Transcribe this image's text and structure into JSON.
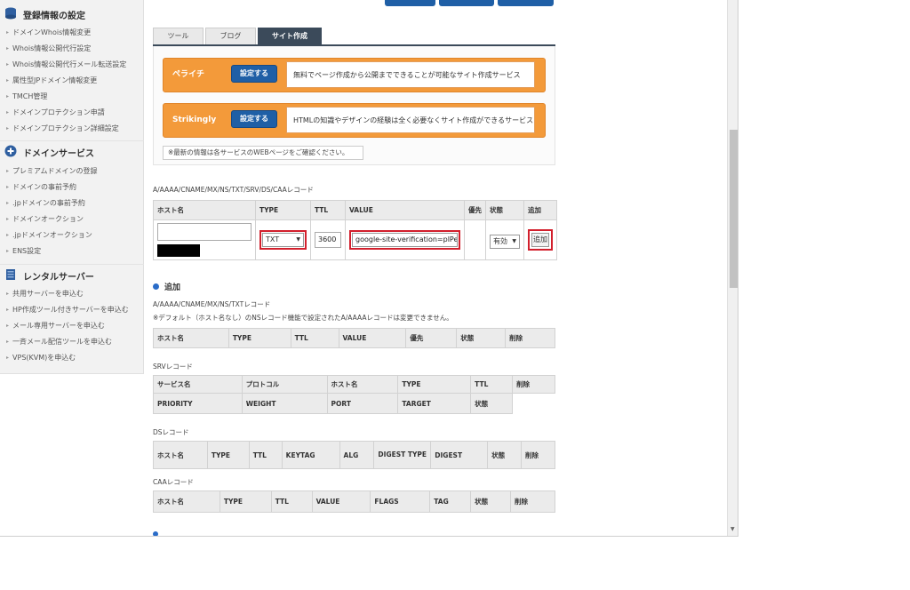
{
  "sidebar": {
    "sections": [
      {
        "title": "登録情報の設定",
        "items": [
          "ドメインWhois情報変更",
          "Whois情報公開代行設定",
          "Whois情報公開代行メール転送設定",
          "属性型JPドメイン情報変更",
          "TMCH管理",
          "ドメインプロテクション申請",
          "ドメインプロテクション詳細設定"
        ]
      },
      {
        "title": "ドメインサービス",
        "items": [
          "プレミアムドメインの登録",
          "ドメインの事前予約",
          ".jpドメインの事前予約",
          "ドメインオークション",
          ".jpドメインオークション",
          "ENS設定"
        ]
      },
      {
        "title": "レンタルサーバー",
        "items": [
          "共用サーバーを申込む",
          "HP作成ツール付きサーバーを申込む",
          "メール専用サーバーを申込む",
          "一斉メール配信ツールを申込む",
          "VPS(KVM)を申込む"
        ]
      }
    ]
  },
  "tabs": [
    "ツール",
    "ブログ",
    "サイト作成"
  ],
  "promos": [
    {
      "name": "ペライチ",
      "button": "設定する",
      "desc": "無料でページ作成から公開までできることが可能なサイト作成サービス"
    },
    {
      "name": "Strikingly",
      "button": "設定する",
      "desc": "HTMLの知識やデザインの経験は全く必要なくサイト作成ができるサービス"
    }
  ],
  "notice": "※最新の情報は各サービスのWEBページをご確認ください。",
  "add_form": {
    "label": "A/AAAA/CNAME/MX/NS/TXT/SRV/DS/CAAレコード",
    "headers": [
      "ホスト名",
      "TYPE",
      "TTL",
      "VALUE",
      "優先",
      "状態",
      "追加"
    ],
    "host_value": "",
    "type_value": "TXT",
    "ttl_value": "3600",
    "value_value": "google-site-verification=plPe",
    "status_value": "有効",
    "add_button": "追加"
  },
  "add_heading": "追加",
  "records": {
    "label": "A/AAAA/CNAME/MX/NS/TXTレコード",
    "note": "※デフォルト（ホスト名なし）のNSレコード機能で設定されたA/AAAAレコードは変更できません。",
    "headers": [
      "ホスト名",
      "TYPE",
      "TTL",
      "VALUE",
      "優先",
      "状態",
      "削除"
    ]
  },
  "srv": {
    "label": "SRVレコード",
    "row1": [
      "サービス名",
      "プロトコル",
      "ホスト名",
      "TYPE",
      "TTL",
      "削除"
    ],
    "row2": [
      "PRIORITY",
      "WEIGHT",
      "PORT",
      "TARGET",
      "状態"
    ]
  },
  "ds": {
    "label": "DSレコード",
    "headers": [
      "ホスト名",
      "TYPE",
      "TTL",
      "KEYTAG",
      "ALG",
      "DIGEST TYPE",
      "DIGEST",
      "状態",
      "削除"
    ]
  },
  "caa": {
    "label": "CAAレコード",
    "headers": [
      "ホスト名",
      "TYPE",
      "TTL",
      "VALUE",
      "FLAGS",
      "TAG",
      "状態",
      "削除"
    ]
  },
  "colors": {
    "accent": "#1f5fa6",
    "promo": "#f39a3a",
    "tab_active": "#3b4a5a",
    "highlight": "#d21f2c"
  },
  "icons": [
    "database-icon",
    "plus-circle-icon",
    "server-icon",
    "chevron-down-icon"
  ]
}
